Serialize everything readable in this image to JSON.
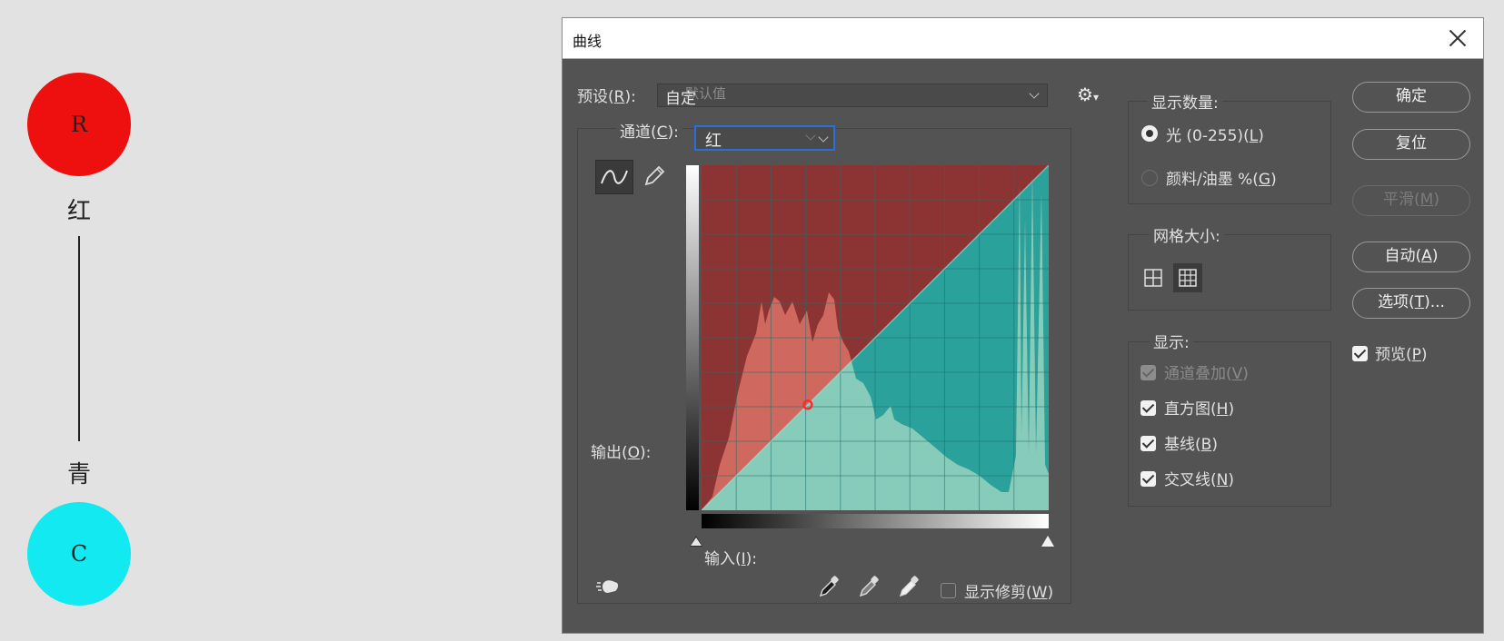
{
  "diagram": {
    "top_circle_letter": "R",
    "top_label": "红",
    "bottom_label": "青",
    "bottom_circle_letter": "C",
    "colors": {
      "red": "#ee0f0f",
      "cyan": "#12e9f0"
    }
  },
  "dialog": {
    "title": "曲线",
    "preset": {
      "label": "预设(",
      "key": "R",
      "label_end": "):",
      "value": "自定",
      "ghost": "默认值"
    },
    "channel": {
      "label": "通道(",
      "key": "C",
      "label_end": "):",
      "value": "红"
    },
    "output_label": {
      "text": "输出(",
      "key": "O",
      "end": "):"
    },
    "input_label": {
      "text": "输入(",
      "key": "I",
      "end": "):"
    },
    "show_clipping": {
      "text": "显示修剪(",
      "key": "W",
      "end": ")",
      "checked": false
    },
    "display_amount": {
      "title": "显示数量:",
      "options": [
        {
          "text": "光 (0-255)(",
          "key": "L",
          "end": ")",
          "selected": true
        },
        {
          "text": "颜料/油墨 %(",
          "key": "G",
          "end": ")",
          "selected": false
        }
      ]
    },
    "grid_size": {
      "title": "网格大小:",
      "selected": "detailed"
    },
    "show": {
      "title": "显示:",
      "options": [
        {
          "text": "通道叠加(",
          "key": "V",
          "end": ")",
          "checked": true,
          "enabled": false
        },
        {
          "text": "直方图(",
          "key": "H",
          "end": ")",
          "checked": true,
          "enabled": true
        },
        {
          "text": "基线(",
          "key": "B",
          "end": ")",
          "checked": true,
          "enabled": true
        },
        {
          "text": "交叉线(",
          "key": "N",
          "end": ")",
          "checked": true,
          "enabled": true
        }
      ]
    },
    "buttons": {
      "ok": "确定",
      "reset": "复位",
      "smooth": {
        "text": "平滑(",
        "key": "M",
        "end": ")",
        "enabled": false
      },
      "auto": {
        "text": "自动(",
        "key": "A",
        "end": ")"
      },
      "options": {
        "text": "选项(",
        "key": "T",
        "end": ")..."
      }
    },
    "preview": {
      "text": "预览(",
      "key": "P",
      "end": ")",
      "checked": true
    },
    "curve": {
      "channel_color": "#e14a43",
      "complement_color": "#2aa19b",
      "control_point": {
        "input": 78,
        "output": 78
      }
    }
  }
}
